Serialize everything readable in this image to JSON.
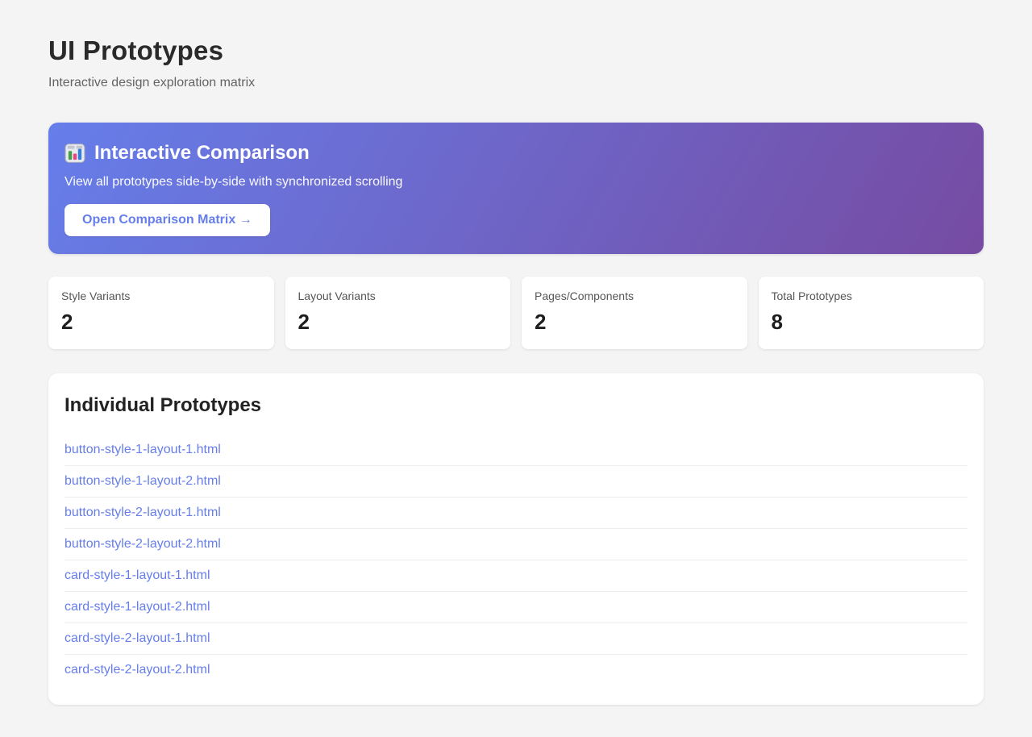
{
  "page": {
    "title": "UI Prototypes",
    "subtitle": "Interactive design exploration matrix",
    "background_color": "#f4f4f5"
  },
  "banner": {
    "icon": "bar-chart-icon",
    "title": "Interactive Comparison",
    "description": "View all prototypes side-by-side with synchronized scrolling",
    "button_label": "Open Comparison Matrix →",
    "gradient_start": "#667eea",
    "gradient_end": "#764ba2",
    "button_text_color": "#667eea",
    "icon_bar_colors": [
      "#43a047",
      "#e9447d",
      "#2f7fe0"
    ]
  },
  "stats": [
    {
      "label": "Style Variants",
      "value": "2"
    },
    {
      "label": "Layout Variants",
      "value": "2"
    },
    {
      "label": "Pages/Components",
      "value": "2"
    },
    {
      "label": "Total Prototypes",
      "value": "8"
    }
  ],
  "prototypes": {
    "heading": "Individual Prototypes",
    "link_color": "#667eea",
    "links": [
      "button-style-1-layout-1.html",
      "button-style-1-layout-2.html",
      "button-style-2-layout-1.html",
      "button-style-2-layout-2.html",
      "card-style-1-layout-1.html",
      "card-style-1-layout-2.html",
      "card-style-2-layout-1.html",
      "card-style-2-layout-2.html"
    ]
  }
}
